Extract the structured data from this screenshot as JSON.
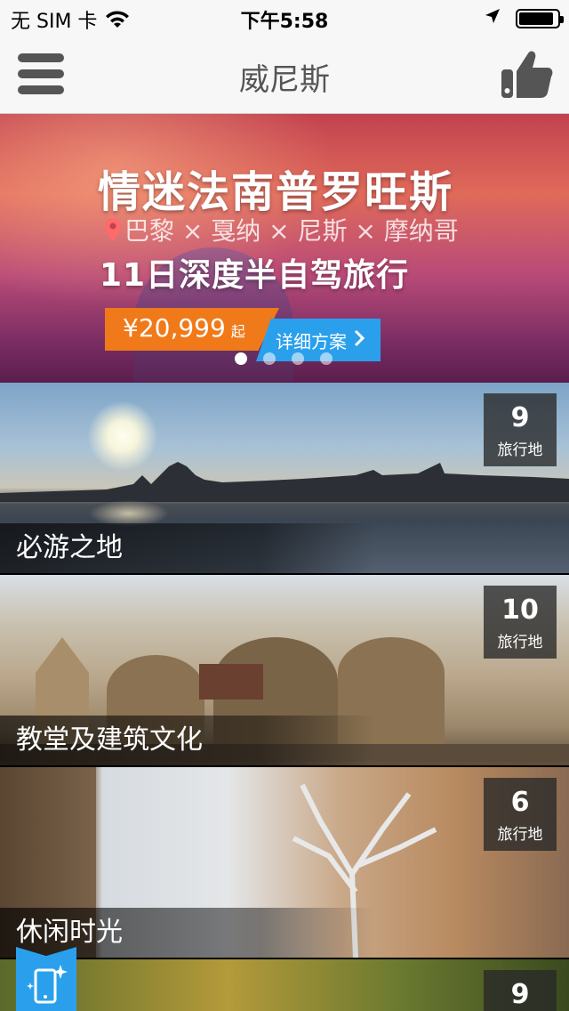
{
  "status_bar": {
    "carrier": "无 SIM 卡",
    "time": "下午5:58",
    "battery_level": 0.9
  },
  "nav": {
    "title": "威尼斯",
    "menu_icon": "hamburger-menu-icon",
    "like_icon": "thumbs-up-icon"
  },
  "banner": {
    "headline": "情迷法南普罗旺斯",
    "route": "巴黎 × 戛纳 × 尼斯 × 摩纳哥",
    "subline": "11日深度半自驾旅行",
    "price": "¥20,999",
    "price_suffix": "起",
    "details_label": "详细方案",
    "active_dot_index": 0,
    "dot_count": 4
  },
  "categories": [
    {
      "label": "必游之地",
      "count": "9",
      "unit": "旅行地"
    },
    {
      "label": "教堂及建筑文化",
      "count": "10",
      "unit": "旅行地"
    },
    {
      "label": "休闲时光",
      "count": "6",
      "unit": "旅行地"
    },
    {
      "label": "",
      "count": "9",
      "unit": ""
    }
  ],
  "colors": {
    "accent_blue": "#2aa0ec",
    "price_orange": "#f07a1a"
  }
}
